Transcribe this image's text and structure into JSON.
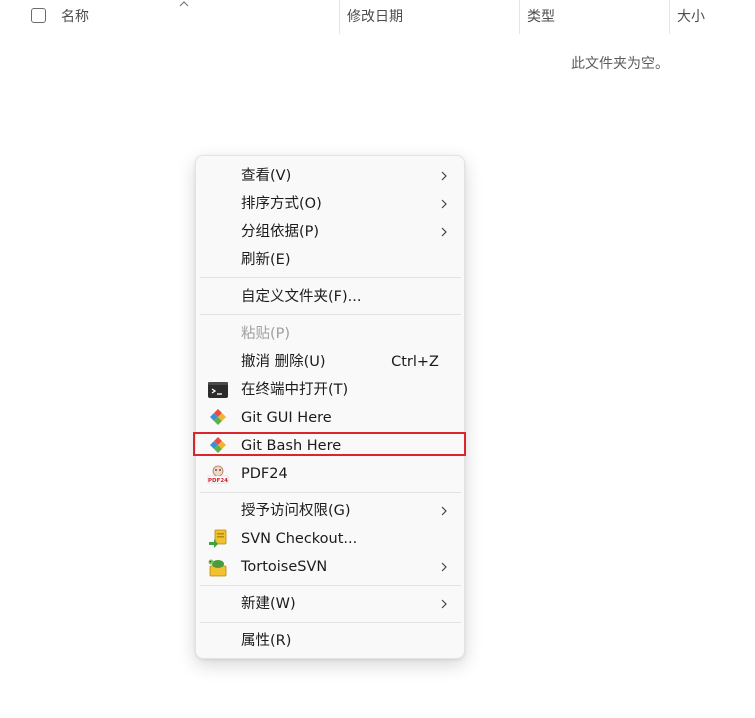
{
  "header": {
    "col_name": "名称",
    "col_modified": "修改日期",
    "col_type": "类型",
    "col_size": "大小"
  },
  "empty_message": "此文件夹为空。",
  "context_menu": {
    "items": [
      {
        "label": "查看(V)",
        "submenu": true
      },
      {
        "label": "排序方式(O)",
        "submenu": true
      },
      {
        "label": "分组依据(P)",
        "submenu": true
      },
      {
        "label": "刷新(E)"
      },
      {
        "label": "自定义文件夹(F)..."
      },
      {
        "label": "粘贴(P)",
        "disabled": true
      },
      {
        "label": "撤消 删除(U)",
        "shortcut": "Ctrl+Z"
      },
      {
        "label": "在终端中打开(T)",
        "icon": "terminal-icon"
      },
      {
        "label": "Git GUI Here",
        "icon": "git-icon"
      },
      {
        "label": "Git Bash Here",
        "icon": "git-icon",
        "highlighted": true
      },
      {
        "label": "PDF24",
        "icon": "pdf24-icon"
      },
      {
        "label": "授予访问权限(G)",
        "submenu": true
      },
      {
        "label": "SVN Checkout...",
        "icon": "svn-checkout-icon"
      },
      {
        "label": "TortoiseSVN",
        "icon": "tortoisesvn-icon",
        "submenu": true
      },
      {
        "label": "新建(W)",
        "submenu": true
      },
      {
        "label": "属性(R)"
      }
    ]
  },
  "colors": {
    "highlight_border": "#d9252c",
    "menu_background": "#f9f9f9",
    "disabled_text": "#a0a0a0"
  }
}
